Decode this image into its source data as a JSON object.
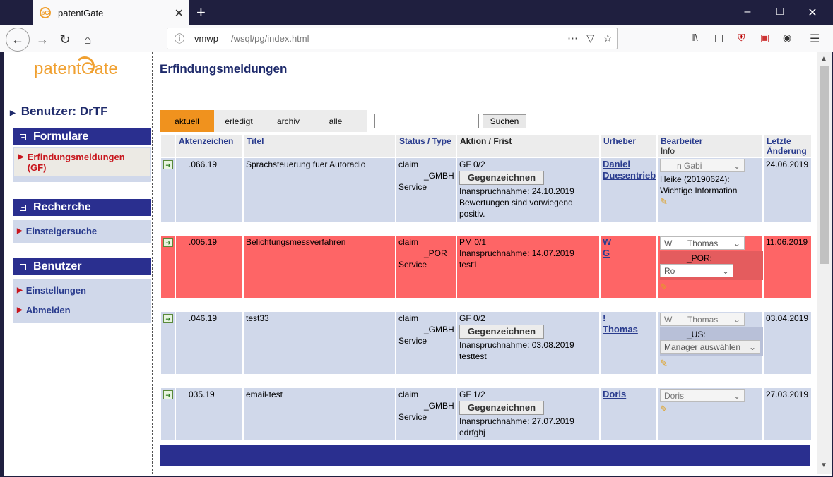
{
  "browser": {
    "tab_title": "patentGate",
    "tab_favicon": "pG",
    "url_host": "vmwp",
    "url_path": "/wsql/pg/index.html",
    "close_glyph": "✕",
    "new_tab_glyph": "+"
  },
  "sidebar": {
    "logo": "patentGate",
    "user_label": "Benutzer: DrTF",
    "sections": [
      {
        "title": "Formulare",
        "items": [
          "Erfindungsmeldungen (GF)"
        ]
      },
      {
        "title": "Recherche",
        "items": [
          "Einsteigersuche"
        ]
      },
      {
        "title": "Benutzer",
        "items": [
          "Einstellungen",
          "Abmelden"
        ]
      }
    ]
  },
  "main": {
    "title": "Erfindungsmeldungen",
    "tabs": [
      "aktuell",
      "erledigt",
      "archiv",
      "alle"
    ],
    "active_tab": "aktuell",
    "search_value": "",
    "search_button": "Suchen"
  },
  "table": {
    "headers": {
      "aktenzeichen": "Aktenzeichen",
      "titel": "Titel",
      "status": "Status / Type",
      "aktion": "Aktion / Frist",
      "urheber": "Urheber",
      "bearbeiter": "Bearbeiter",
      "bearbeiter_info": "Info",
      "letzte": "Letzte Änderung"
    },
    "rows": [
      {
        "az": ".066.19",
        "titel": "Sprachsteuerung fuer Autoradio",
        "status1": "claim",
        "status2": "_GMBH",
        "status3": "Service",
        "aktion1": "GF 0/2",
        "button": "Gegenzeichnen",
        "aktion2": "Inanspruchnahme: 24.10.2019",
        "aktion3": "Bewertungen sind vorwiegend positiv.",
        "urheber": "Daniel Duesentrieb",
        "bearbeiter": "n Gabi",
        "info1": "Heike (20190624):",
        "info2": "Wichtige Information",
        "datum": "24.06.2019"
      },
      {
        "az": ".005.19",
        "titel": "Belichtungsmessverfahren",
        "status1": "claim",
        "status2": "_POR",
        "status3": "Service",
        "aktion1": "PM 0/1",
        "aktion2": "Inanspruchnahme: 14.07.2019",
        "aktion3": "test1",
        "urheber1": "W",
        "urheber2": "G",
        "bearbeiter_a": "W",
        "bearbeiter_b": "Thomas",
        "manager_label": "_POR:",
        "manager_value": "Ro",
        "datum": "11.06.2019"
      },
      {
        "az": ".046.19",
        "titel": "test33",
        "status1": "claim",
        "status2": "_GMBH",
        "status3": "Service",
        "aktion1": "GF 0/2",
        "button": "Gegenzeichnen",
        "aktion2": "Inanspruchnahme: 03.08.2019",
        "aktion3": "testtest",
        "urheber1": "!",
        "urheber2": "Thomas",
        "bearbeiter_a": "W",
        "bearbeiter_b": "Thomas",
        "manager_label": "_US:",
        "manager_value": "Manager auswählen",
        "datum": "03.04.2019"
      },
      {
        "az": "035.19",
        "titel": "email-test",
        "status1": "claim",
        "status2": "_GMBH",
        "status3": "Service",
        "aktion1": "GF 1/2",
        "button": "Gegenzeichnen",
        "aktion2": "Inanspruchnahme: 27.07.2019",
        "aktion3": "edrfghj",
        "urheber": "Doris",
        "bearbeiter": "Doris",
        "datum": "27.03.2019"
      }
    ]
  },
  "colors": {
    "nav_blue": "#2a2f8f",
    "row_blue": "#d0d8ea",
    "row_red": "#fe6566",
    "accent_orange": "#f0921e"
  },
  "icons": [
    "back-icon",
    "forward-icon",
    "reload-icon",
    "home-icon",
    "info-icon",
    "more-icon",
    "pocket-icon",
    "star-icon",
    "library-icon",
    "sidebar-icon",
    "ublock-icon",
    "extension-icon",
    "account-icon",
    "menu-icon",
    "pencil-icon",
    "open-record-icon"
  ]
}
